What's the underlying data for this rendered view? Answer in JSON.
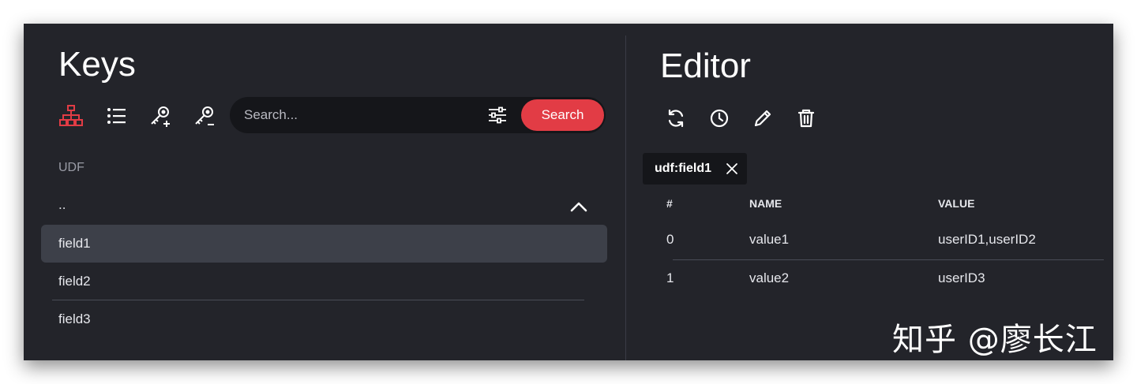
{
  "keys": {
    "title": "Keys",
    "toolbar": {
      "tree_icon": "tree-view-icon",
      "list_icon": "list-view-icon",
      "add_key_icon": "key-add-icon",
      "remove_key_icon": "key-remove-icon",
      "active_color": "#e23c45"
    },
    "search": {
      "placeholder": "Search...",
      "value": "",
      "filter_icon": "sliders-icon",
      "button_label": "Search"
    },
    "section_label": "UDF",
    "parent_label": "..",
    "items": [
      {
        "label": "field1",
        "selected": true
      },
      {
        "label": "field2",
        "selected": false
      },
      {
        "label": "field3",
        "selected": false
      }
    ]
  },
  "editor": {
    "title": "Editor",
    "toolbar": {
      "refresh_icon": "refresh-icon",
      "ttl_icon": "clock-icon",
      "edit_icon": "pencil-icon",
      "delete_icon": "trash-icon"
    },
    "tab": {
      "label": "udf:field1",
      "close_icon": "close-icon"
    },
    "table": {
      "headers": [
        "#",
        "NAME",
        "VALUE"
      ],
      "rows": [
        [
          "0",
          "value1",
          "userID1,userID2"
        ],
        [
          "1",
          "value2",
          "userID3"
        ]
      ]
    }
  },
  "watermark": "知乎 @廖长江",
  "colors": {
    "accent": "#e23c45",
    "background": "#23242a",
    "selected_row": "#3d4049"
  }
}
